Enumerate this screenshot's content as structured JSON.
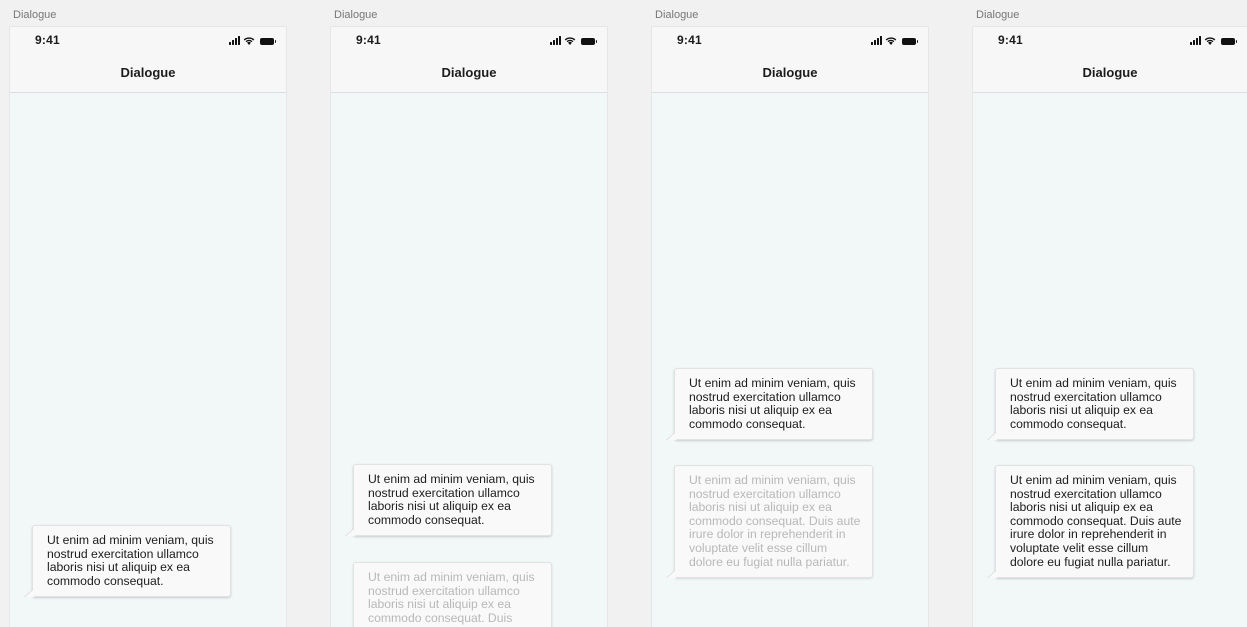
{
  "frames": [
    {
      "label": "Dialogue",
      "status": {
        "time": "9:41"
      },
      "title": "Dialogue",
      "messages": [
        "Ut enim ad minim veniam, quis nostrud exercitation ullamco laboris nisi ut aliquip ex ea commodo consequat."
      ]
    },
    {
      "label": "Dialogue",
      "status": {
        "time": "9:41"
      },
      "title": "Dialogue",
      "messages": [
        "Ut enim ad minim veniam, quis nostrud exercitation ullamco laboris nisi ut aliquip ex ea commodo consequat.",
        "Ut enim ad minim veniam, quis nostrud exercitation ullamco laboris nisi ut aliquip ex ea commodo consequat. Duis"
      ]
    },
    {
      "label": "Dialogue",
      "status": {
        "time": "9:41"
      },
      "title": "Dialogue",
      "messages": [
        "Ut enim ad minim veniam, quis nostrud exercitation ullamco laboris nisi ut aliquip ex ea commodo consequat.",
        "Ut enim ad minim veniam, quis nostrud exercitation ullamco laboris nisi ut aliquip ex ea commodo consequat. Duis aute irure dolor in reprehenderit in voluptate velit esse cillum dolore eu fugiat nulla pariatur."
      ]
    },
    {
      "label": "Dialogue",
      "status": {
        "time": "9:41"
      },
      "title": "Dialogue",
      "messages": [
        "Ut enim ad minim veniam, quis nostrud exercitation ullamco laboris nisi ut aliquip ex ea commodo consequat.",
        "Ut enim ad minim veniam, quis nostrud exercitation ullamco laboris nisi ut aliquip ex ea commodo consequat. Duis aute irure dolor in reprehenderit in voluptate velit esse cillum dolore eu fugiat nulla pariatur."
      ]
    }
  ]
}
